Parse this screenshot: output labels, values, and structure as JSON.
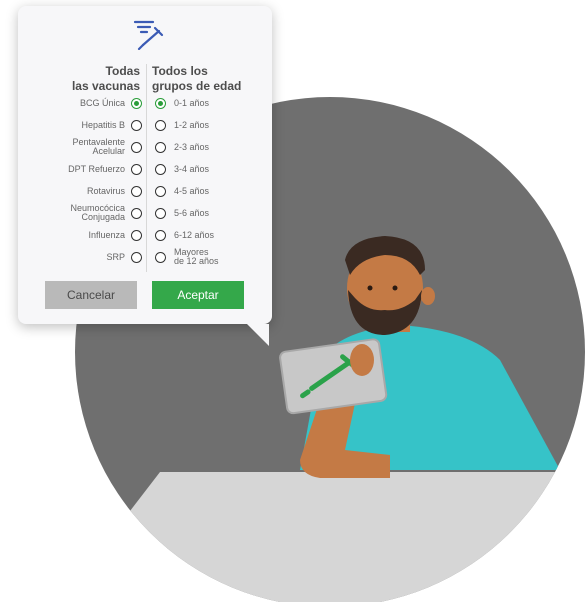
{
  "colors": {
    "accent": "#34a84a",
    "icon_blue": "#3b5bb5",
    "cancel_bg": "#b9b9b9"
  },
  "filter_icon": "filter-syringe-icon",
  "vaccines": {
    "header_line1": "Todas",
    "header_line2": "las vacunas",
    "items": [
      {
        "line1": "BCG Única",
        "line2": "",
        "selected": true
      },
      {
        "line1": "Hepatitis B",
        "line2": "",
        "selected": false
      },
      {
        "line1": "Pentavalente",
        "line2": "Acelular",
        "selected": false
      },
      {
        "line1": "DPT Refuerzo",
        "line2": "",
        "selected": false
      },
      {
        "line1": "Rotavirus",
        "line2": "",
        "selected": false
      },
      {
        "line1": "Neumocócica",
        "line2": "Conjugada",
        "selected": false
      },
      {
        "line1": "Influenza",
        "line2": "",
        "selected": false
      },
      {
        "line1": "SRP",
        "line2": "",
        "selected": false
      }
    ]
  },
  "ages": {
    "header_line1": "Todos los",
    "header_line2": "grupos de edad",
    "items": [
      {
        "line1": "0-1 años",
        "line2": "",
        "selected": true
      },
      {
        "line1": "1-2 años",
        "line2": "",
        "selected": false
      },
      {
        "line1": "2-3 años",
        "line2": "",
        "selected": false
      },
      {
        "line1": "3-4 años",
        "line2": "",
        "selected": false
      },
      {
        "line1": "4-5 años",
        "line2": "",
        "selected": false
      },
      {
        "line1": "5-6 años",
        "line2": "",
        "selected": false
      },
      {
        "line1": "6-12 años",
        "line2": "",
        "selected": false
      },
      {
        "line1": "Mayores",
        "line2": "de 12 años",
        "selected": false
      }
    ]
  },
  "buttons": {
    "cancel": "Cancelar",
    "accept": "Aceptar"
  }
}
